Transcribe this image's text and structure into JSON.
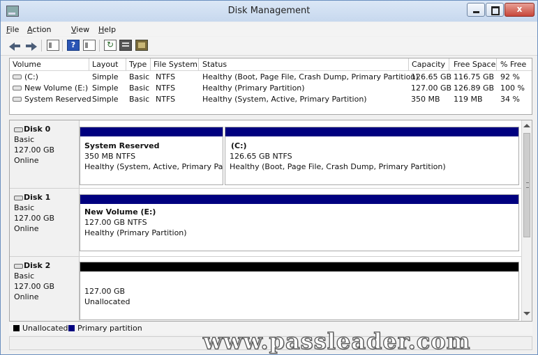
{
  "window": {
    "title": "Disk Management",
    "close_glyph": "x"
  },
  "menu": [
    {
      "accel": "F",
      "rest": "ile"
    },
    {
      "accel": "A",
      "rest": "ction"
    },
    {
      "accel": "V",
      "rest": "iew"
    },
    {
      "accel": "H",
      "rest": "elp"
    }
  ],
  "toolbar": {
    "icons": [
      "back-icon",
      "forward-icon",
      "console-tree-icon",
      "help-icon",
      "show-hide-icon",
      "refresh-icon",
      "properties-icon",
      "rescan-disks-icon"
    ],
    "help_glyph": "?",
    "refresh_glyph": "↻"
  },
  "volume_list": {
    "columns": [
      "Volume",
      "Layout",
      "Type",
      "File System",
      "Status",
      "Capacity",
      "Free Space",
      "% Free"
    ],
    "rows": [
      {
        "volume": "(C:)",
        "layout": "Simple",
        "type": "Basic",
        "fs": "NTFS",
        "status": "Healthy (Boot, Page File, Crash Dump, Primary Partition)",
        "capacity": "126.65 GB",
        "free": "116.75 GB",
        "pct": "92 %"
      },
      {
        "volume": "New Volume (E:)",
        "layout": "Simple",
        "type": "Basic",
        "fs": "NTFS",
        "status": "Healthy (Primary Partition)",
        "capacity": "127.00 GB",
        "free": "126.89 GB",
        "pct": "100 %"
      },
      {
        "volume": "System Reserved",
        "layout": "Simple",
        "type": "Basic",
        "fs": "NTFS",
        "status": "Healthy (System, Active, Primary Partition)",
        "capacity": "350 MB",
        "free": "119 MB",
        "pct": "34 %"
      }
    ]
  },
  "disks": [
    {
      "name": "Disk 0",
      "kind": "Basic",
      "size": "127.00 GB",
      "state": "Online",
      "partitions": [
        {
          "name": "System Reserved",
          "line1": "350 MB NTFS",
          "line2": "Healthy (System, Active, Primary Partit"
        },
        {
          "name": "(C:)",
          "line1": "126.65 GB NTFS",
          "line2": "Healthy (Boot, Page File, Crash Dump, Primary Partition)"
        }
      ]
    },
    {
      "name": "Disk 1",
      "kind": "Basic",
      "size": "127.00 GB",
      "state": "Online",
      "partitions": [
        {
          "name": "New Volume  (E:)",
          "line1": "127.00 GB NTFS",
          "line2": "Healthy (Primary Partition)"
        }
      ]
    },
    {
      "name": "Disk 2",
      "kind": "Basic",
      "size": "127.00 GB",
      "state": "Online",
      "partitions": [
        {
          "name": "",
          "line1": "127.00 GB",
          "line2": "Unallocated"
        }
      ]
    }
  ],
  "legend": [
    {
      "label": "Unallocated",
      "color": "#000000"
    },
    {
      "label": "Primary partition",
      "color": "#00007f"
    }
  ],
  "colors": {
    "primary_bar": "#00007f",
    "unallocated_bar": "#000000"
  },
  "watermark": "www.passleader.com"
}
